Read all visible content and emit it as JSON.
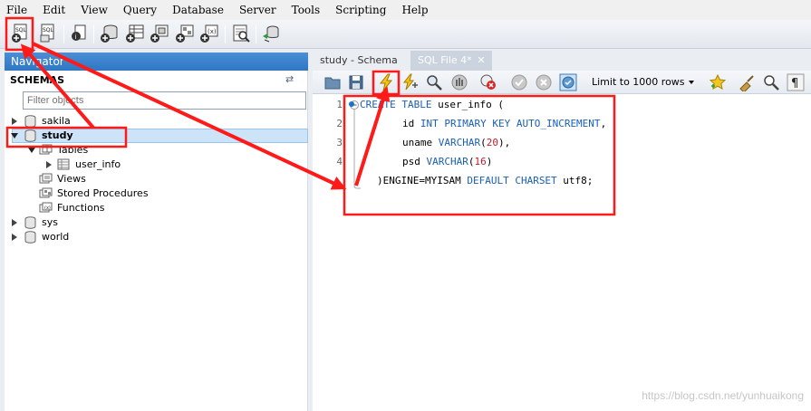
{
  "menu": [
    "File",
    "Edit",
    "View",
    "Query",
    "Database",
    "Server",
    "Tools",
    "Scripting",
    "Help"
  ],
  "navigator": {
    "title": "Navigator",
    "schemas_label": "SCHEMAS",
    "filter_placeholder": "Filter objects",
    "schemas": [
      "sakila",
      "study",
      "sys",
      "world"
    ],
    "study_children": {
      "tables_label": "Tables",
      "table_item": "user_info",
      "views_label": "Views",
      "procedures_label": "Stored Procedures",
      "functions_label": "Functions"
    }
  },
  "tabs": {
    "schema_tab": "study - Schema",
    "sql_tab": "SQL File 4*"
  },
  "editor_toolbar": {
    "limit": "Limit to 1000 rows"
  },
  "editor": {
    "line_numbers": [
      "1",
      "2",
      "3",
      "4"
    ],
    "line1": {
      "kw": "CREATE TABLE",
      "rest": " user_info ("
    },
    "line2": {
      "name": "id",
      "kw": "INT PRIMARY KEY AUTO_INCREMENT",
      "end": ","
    },
    "line3": {
      "name": "uname",
      "kw": "VARCHAR",
      "open": "(",
      "num": "20",
      "close": "),"
    },
    "line4": {
      "name": "psd",
      "kw": "VARCHAR",
      "open": "(",
      "num": "16",
      "close": ")"
    },
    "line5": {
      "start": ")ENGINE=MYISAM",
      "kw": "DEFAULT CHARSET",
      "rest": " utf8;"
    }
  },
  "watermark": "https://blog.csdn.net/yunhuaikong",
  "colors": {
    "annotation": "#ff1a1a",
    "keyword": "#1a5fb4",
    "number": "#c01c28",
    "nav_header": "#2f76c4"
  }
}
